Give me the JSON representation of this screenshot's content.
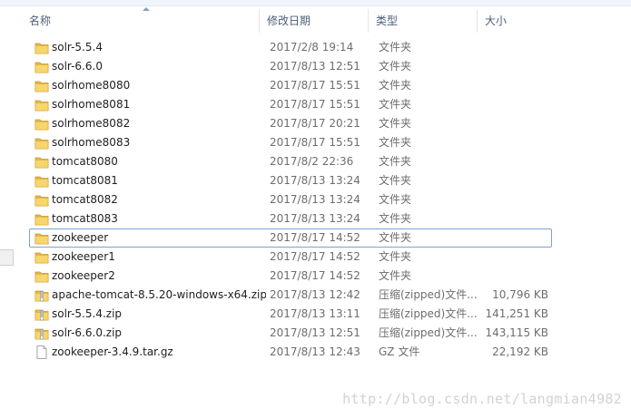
{
  "columns": {
    "name": "名称",
    "date": "修改日期",
    "type": "类型",
    "size": "大小"
  },
  "files": [
    {
      "name": "solr-5.5.4",
      "date": "2017/2/8 19:14",
      "type": "文件夹",
      "size": "",
      "icon": "folder-icon"
    },
    {
      "name": "solr-6.6.0",
      "date": "2017/8/13 12:51",
      "type": "文件夹",
      "size": "",
      "icon": "folder-icon"
    },
    {
      "name": "solrhome8080",
      "date": "2017/8/17 15:51",
      "type": "文件夹",
      "size": "",
      "icon": "folder-icon"
    },
    {
      "name": "solrhome8081",
      "date": "2017/8/17 15:51",
      "type": "文件夹",
      "size": "",
      "icon": "folder-icon"
    },
    {
      "name": "solrhome8082",
      "date": "2017/8/17 20:21",
      "type": "文件夹",
      "size": "",
      "icon": "folder-icon"
    },
    {
      "name": "solrhome8083",
      "date": "2017/8/17 15:51",
      "type": "文件夹",
      "size": "",
      "icon": "folder-icon"
    },
    {
      "name": "tomcat8080",
      "date": "2017/8/2 22:36",
      "type": "文件夹",
      "size": "",
      "icon": "folder-icon"
    },
    {
      "name": "tomcat8081",
      "date": "2017/8/13 13:24",
      "type": "文件夹",
      "size": "",
      "icon": "folder-icon"
    },
    {
      "name": "tomcat8082",
      "date": "2017/8/13 13:24",
      "type": "文件夹",
      "size": "",
      "icon": "folder-icon"
    },
    {
      "name": "tomcat8083",
      "date": "2017/8/13 13:24",
      "type": "文件夹",
      "size": "",
      "icon": "folder-icon"
    },
    {
      "name": "zookeeper",
      "date": "2017/8/17 14:52",
      "type": "文件夹",
      "size": "",
      "icon": "folder-icon",
      "focused": true
    },
    {
      "name": "zookeeper1",
      "date": "2017/8/17 14:52",
      "type": "文件夹",
      "size": "",
      "icon": "folder-icon"
    },
    {
      "name": "zookeeper2",
      "date": "2017/8/17 14:52",
      "type": "文件夹",
      "size": "",
      "icon": "folder-icon"
    },
    {
      "name": "apache-tomcat-8.5.20-windows-x64.zip",
      "date": "2017/8/13 12:42",
      "type": "压缩(zipped)文件...",
      "size": "10,796 KB",
      "icon": "zip-archive-icon"
    },
    {
      "name": "solr-5.5.4.zip",
      "date": "2017/8/13 13:11",
      "type": "压缩(zipped)文件...",
      "size": "141,251 KB",
      "icon": "zip-archive-icon"
    },
    {
      "name": "solr-6.6.0.zip",
      "date": "2017/8/13 12:51",
      "type": "压缩(zipped)文件...",
      "size": "143,115 KB",
      "icon": "zip-archive-icon"
    },
    {
      "name": "zookeeper-3.4.9.tar.gz",
      "date": "2017/8/13 12:43",
      "type": "GZ 文件",
      "size": "22,192 KB",
      "icon": "file-icon"
    }
  ],
  "watermark": "http://blog.csdn.net/langmian4982"
}
